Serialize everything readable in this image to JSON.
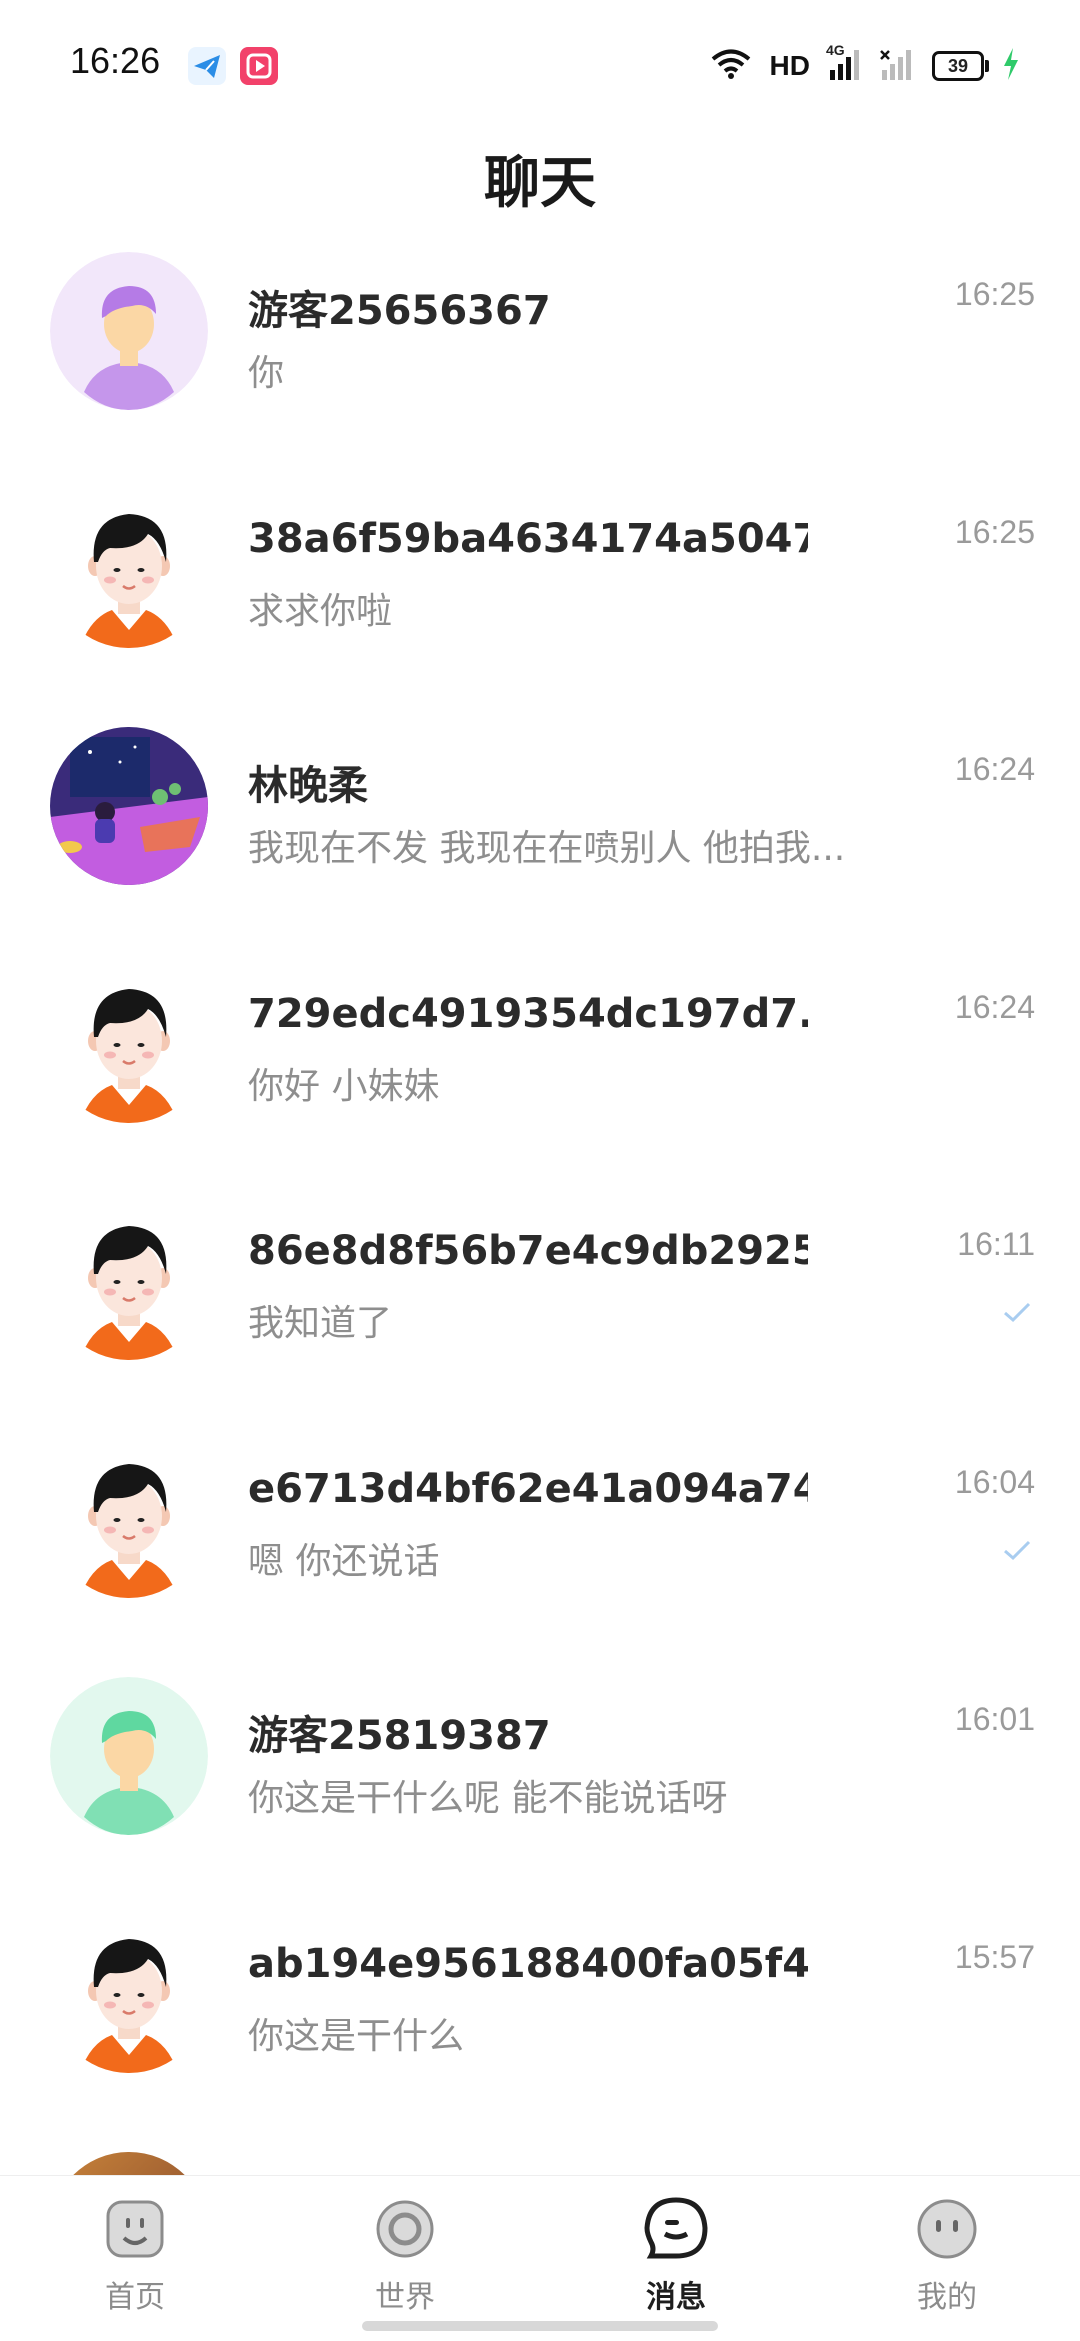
{
  "status_bar": {
    "time": "16:26",
    "network_label": "HD",
    "network_type": "4G",
    "battery": "39",
    "charging": true
  },
  "header": {
    "title": "聊天"
  },
  "chats": [
    {
      "name": "游客25656367",
      "preview": "你",
      "time": "16:25",
      "avatar": "purple-guest-avatar",
      "read": false
    },
    {
      "name": "38a6f59ba4634174a5047...",
      "preview": "求求你啦",
      "time": "16:25",
      "avatar": "default-boy-avatar",
      "read": false
    },
    {
      "name": "林晚柔",
      "preview": "我现在不发 我现在在喷别人 他拍我...",
      "time": "16:24",
      "avatar": "illustration-room-avatar",
      "read": false
    },
    {
      "name": "729edc4919354dc197d7...",
      "preview": "你好 小妹妹",
      "time": "16:24",
      "avatar": "default-boy-avatar",
      "read": false
    },
    {
      "name": "86e8d8f56b7e4c9db2925...",
      "preview": "我知道了",
      "time": "16:11",
      "avatar": "default-boy-avatar",
      "read": true
    },
    {
      "name": "e6713d4bf62e41a094a74...",
      "preview": "嗯 你还说话",
      "time": "16:04",
      "avatar": "default-boy-avatar",
      "read": true
    },
    {
      "name": "游客25819387",
      "preview": "你这是干什么呢 能不能说话呀",
      "time": "16:01",
      "avatar": "green-guest-avatar",
      "read": false
    },
    {
      "name": "ab194e956188400fa05f4...",
      "preview": "你这是干什么",
      "time": "15:57",
      "avatar": "default-boy-avatar",
      "read": false
    }
  ],
  "bottom_nav": [
    {
      "label": "首页",
      "icon": "home-face-icon",
      "active": false
    },
    {
      "label": "世界",
      "icon": "world-ring-icon",
      "active": false
    },
    {
      "label": "消息",
      "icon": "message-bubble-icon",
      "active": true
    },
    {
      "label": "我的",
      "icon": "profile-face-icon",
      "active": false
    }
  ],
  "colors": {
    "name_text": "#2b2b2b",
    "preview_text": "#8e8e8e",
    "time_text": "#9a9a9a",
    "read_check": "#a9cdf0",
    "nav_inactive": "#8c8c8c",
    "nav_active": "#1e1e1e"
  }
}
